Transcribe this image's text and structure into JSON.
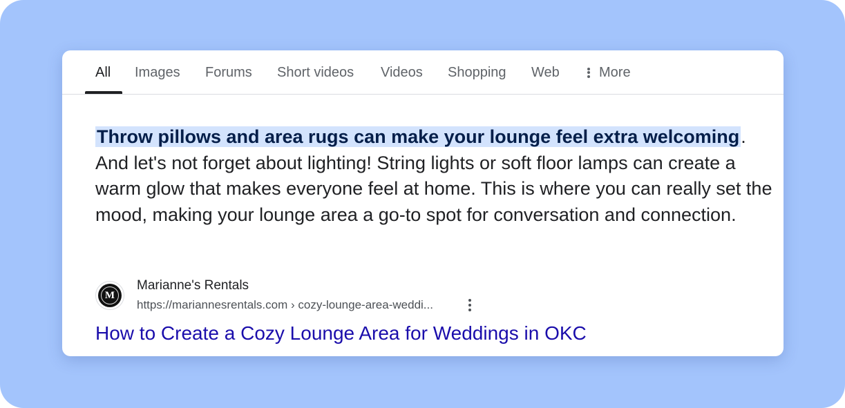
{
  "tabs": {
    "items": [
      {
        "label": "All",
        "active": true
      },
      {
        "label": "Images"
      },
      {
        "label": "Forums"
      },
      {
        "label": "Short videos"
      },
      {
        "label": "Videos"
      },
      {
        "label": "Shopping"
      },
      {
        "label": "Web"
      }
    ],
    "more_label": "More",
    "more_icon": "more-vert-icon"
  },
  "snippet": {
    "highlight": "Throw pillows and area rugs can make your lounge feel extra welcoming",
    "body": ". And let's not forget about lighting! String lights or soft floor lamps can create a warm glow that makes everyone feel at home. This is where you can really set the mood, making your lounge area a go-to spot for conversation and connection."
  },
  "source": {
    "favicon_letter": "M",
    "name": "Marianne's Rentals",
    "url": "https://mariannesrentals.com › cozy-lounge-area-weddi...",
    "menu_icon": "more-vert-icon"
  },
  "result": {
    "title": "How to Create a Cozy Lounge Area for Weddings in OKC"
  },
  "colors": {
    "background": "#a3c4fc",
    "highlight": "#d3e3fd",
    "link": "#1a0dab",
    "text": "#202124"
  }
}
